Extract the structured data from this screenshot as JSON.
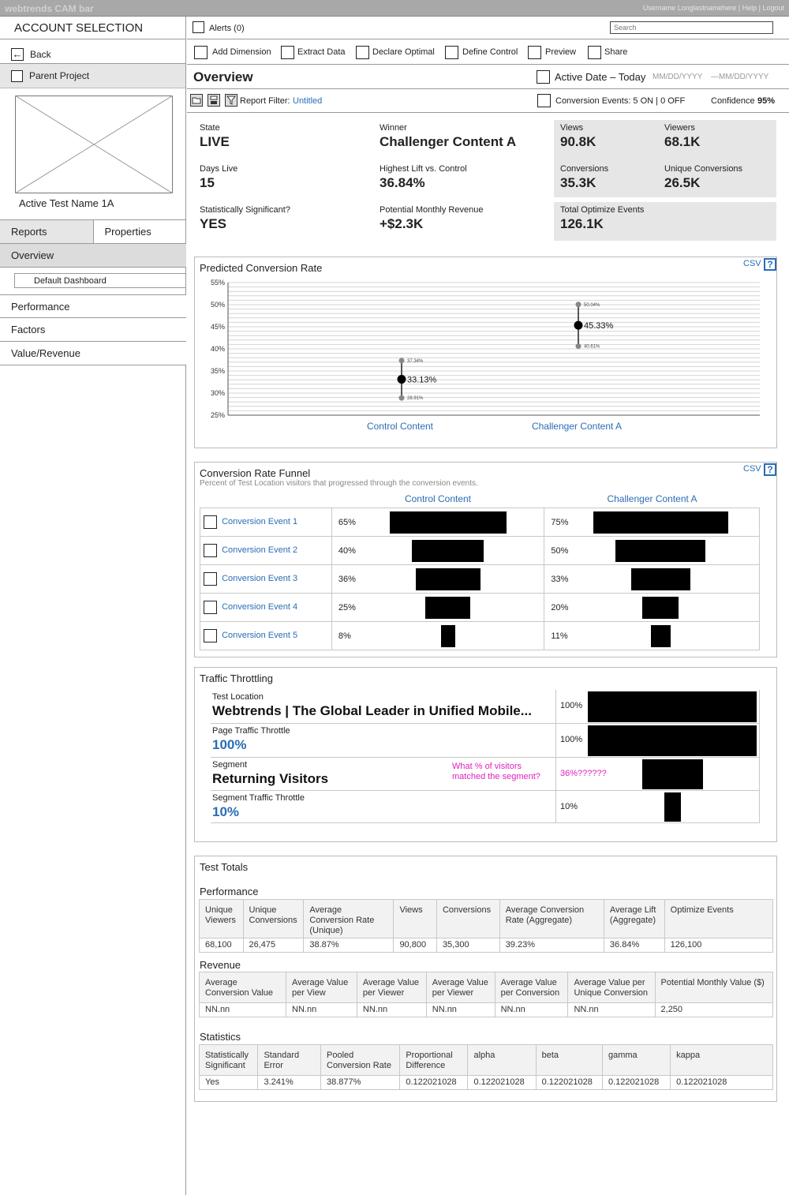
{
  "topbar": {
    "brand": "webtrends CAM bar",
    "user_links": "Username Longlastnamehere | Help | Logout"
  },
  "sidebar": {
    "account_title": "ACCOUNT SELECTION",
    "back_label": "Back",
    "parent_project_label": "Parent Project",
    "test_name": "Active Test Name 1A",
    "tabs": [
      "Reports",
      "Properties"
    ],
    "nav": {
      "overview": "Overview",
      "default_dashboard": "Default Dashboard",
      "performance": "Performance",
      "factors": "Factors",
      "value_revenue": "Value/Revenue"
    }
  },
  "toolbar": {
    "alerts_label": "Alerts (0)",
    "search_placeholder": "Search",
    "actions": [
      "Add Dimension",
      "Extract Data",
      "Declare Optimal",
      "Define Control",
      "Preview",
      "Share"
    ]
  },
  "header": {
    "page_title": "Overview",
    "active_date_label": "Active Date – Today",
    "date_start_placeholder": "MM/DD/YYYY",
    "date_end_placeholder": "—MM/DD/YYYY",
    "report_filter_label": "Report Filter:",
    "report_filter_value": "Untitled",
    "conversion_events": "Conversion Events: 5 ON | 0 OFF",
    "confidence_label": "Confidence",
    "confidence_value": "95%"
  },
  "summary": {
    "state": {
      "label": "State",
      "value": "LIVE"
    },
    "winner": {
      "label": "Winner",
      "value": "Challenger Content A"
    },
    "days_live": {
      "label": "Days Live",
      "value": "15"
    },
    "highest_lift": {
      "label": "Highest Lift vs. Control",
      "value": "36.84%"
    },
    "stat_sig": {
      "label": "Statistically Significant?",
      "value": "YES"
    },
    "potential_revenue": {
      "label": "Potential Monthly Revenue",
      "value": "+$2.3K"
    },
    "views": {
      "label": "Views",
      "value": "90.8K"
    },
    "viewers": {
      "label": "Viewers",
      "value": "68.1K"
    },
    "conversions": {
      "label": "Conversions",
      "value": "35.3K"
    },
    "unique_conversions": {
      "label": "Unique Conversions",
      "value": "26.5K"
    },
    "total_optimize_events": {
      "label": "Total Optimize Events",
      "value": "126.1K"
    }
  },
  "predicted": {
    "title": "Predicted Conversion Rate",
    "csv_label": "CSV",
    "help_label": "?"
  },
  "chart_data": {
    "type": "scatter",
    "title": "Predicted Conversion Rate",
    "categories": [
      "Control Content",
      "Challenger Content A"
    ],
    "y_ticks": [
      "55%",
      "50%",
      "45%",
      "40%",
      "35%",
      "30%",
      "25%"
    ],
    "ylim": [
      25,
      55
    ],
    "points": [
      {
        "category": "Control Content",
        "value": 33.13,
        "upper": 37.34,
        "lower": 28.91,
        "value_label": "33.13%",
        "upper_label": "37.34%",
        "lower_label": "28.91%"
      },
      {
        "category": "Challenger Content A",
        "value": 45.33,
        "upper": 50.04,
        "lower": 40.61,
        "value_label": "45.33%",
        "upper_label": "50.04%",
        "lower_label": "40.61%"
      }
    ],
    "grid": true
  },
  "funnel": {
    "title": "Conversion Rate Funnel",
    "subtitle": "Percent of Test Location visitors that progressed through the conversion events.",
    "csv_label": "CSV",
    "help_label": "?",
    "columns": [
      "Control Content",
      "Challenger Content A"
    ],
    "rows": [
      {
        "event": "Conversion Event 1",
        "control": "65%",
        "control_value": 65,
        "challenger": "75%",
        "challenger_value": 75
      },
      {
        "event": "Conversion Event 2",
        "control": "40%",
        "control_value": 40,
        "challenger": "50%",
        "challenger_value": 50
      },
      {
        "event": "Conversion Event 3",
        "control": "36%",
        "control_value": 36,
        "challenger": "33%",
        "challenger_value": 33
      },
      {
        "event": "Conversion Event 4",
        "control": "25%",
        "control_value": 25,
        "challenger": "20%",
        "challenger_value": 20
      },
      {
        "event": "Conversion Event 5",
        "control": "8%",
        "control_value": 8,
        "challenger": "11%",
        "challenger_value": 11
      }
    ]
  },
  "traffic": {
    "title": "Traffic Throttling",
    "rows": [
      {
        "label": "Test Location",
        "value": "Webtrends | The Global Leader in Unified Mobile...",
        "pct": "100%",
        "level": 100
      },
      {
        "label": "Page Traffic Throttle",
        "value": "100%",
        "pct": "100%",
        "level": 100
      },
      {
        "label": "Segment",
        "value": "Returning Visitors",
        "pct": "36%??????",
        "level": 36,
        "note": "What % of visitors matched the segment?"
      },
      {
        "label": "Segment Traffic Throttle",
        "value": "10%",
        "pct": "10%",
        "level": 10
      }
    ]
  },
  "totals": {
    "title": "Test Totals",
    "performance": {
      "title": "Performance",
      "headers": [
        "Unique Viewers",
        "Unique Conversions",
        "Average Conversion Rate (Unique)",
        "Views",
        "Conversions",
        "Average Conversion Rate (Aggregate)",
        "Average Lift (Aggregate)",
        "Optimize Events"
      ],
      "values": [
        "68,100",
        "26,475",
        "38.87%",
        "90,800",
        "35,300",
        "39.23%",
        "36.84%",
        "126,100"
      ]
    },
    "revenue": {
      "title": "Revenue",
      "headers": [
        "Average Conversion Value",
        "Average Value per View",
        "Average Value per Viewer",
        "Average Value per Viewer",
        "Average Value per Conversion",
        "Average Value per Unique Conversion",
        "Potential Monthly Value ($)"
      ],
      "values": [
        "NN.nn",
        "NN.nn",
        "NN.nn",
        "NN.nn",
        "NN.nn",
        "NN.nn",
        "2,250"
      ]
    },
    "statistics": {
      "title": "Statistics",
      "headers": [
        "Statistically Significant",
        "Standard Error",
        "Pooled Conversion Rate",
        "Proportional Difference",
        "alpha",
        "beta",
        "gamma",
        "kappa"
      ],
      "values": [
        "Yes",
        "3.241%",
        "38.877%",
        "0.122021028",
        "0.122021028",
        "0.122021028",
        "0.122021028",
        "0.122021028"
      ]
    }
  }
}
